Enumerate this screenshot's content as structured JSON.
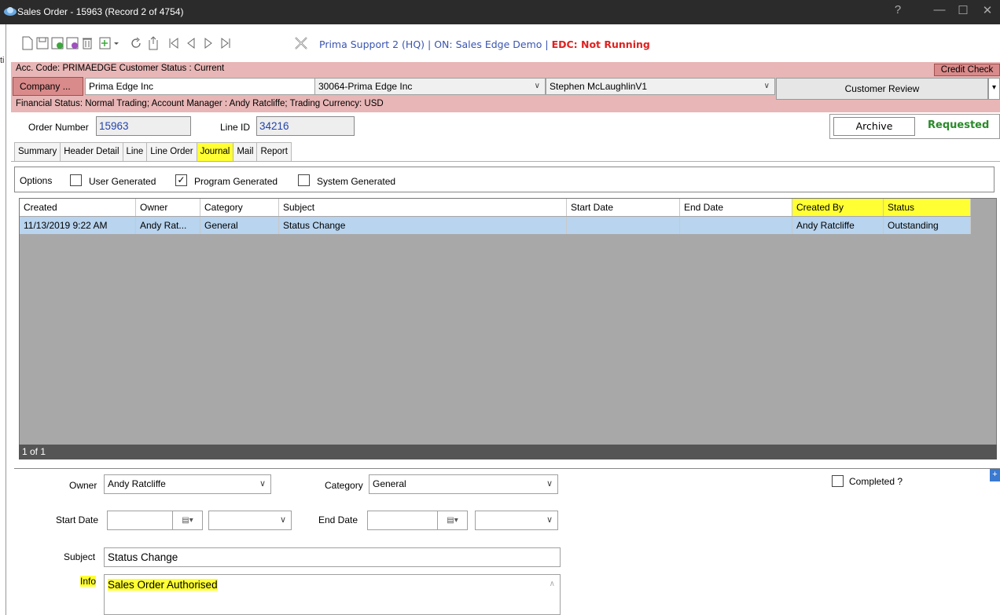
{
  "window": {
    "title": "Sales Order - 15963  (Record 2 of 4754)",
    "help": "?",
    "minimize": "—",
    "maximize": "☐",
    "close": "✕"
  },
  "left_strip_fragment": "ti",
  "toolbar": {
    "connection_text": "Prima Support 2 (HQ) | ON: Sales Edge Demo | ",
    "edc_status": "EDC: Not Running"
  },
  "customer": {
    "acc_line": "Acc. Code: PRIMAEDGE  Customer Status : Current",
    "credit_check": "Credit Check",
    "company_button": "Company ...",
    "company_name": "Prima Edge Inc",
    "account_select": "30064-Prima Edge Inc",
    "contact_select": "Stephen McLaughlinV1",
    "review_button": "Customer Review",
    "financial_line": "Financial Status: Normal Trading;  Account Manager : Andy Ratcliffe; Trading Currency: USD"
  },
  "order": {
    "order_number_label": "Order Number",
    "order_number": "15963",
    "line_id_label": "Line ID",
    "line_id": "34216",
    "archive_button": "Archive",
    "status": "Requested"
  },
  "tabs": [
    "Summary",
    "Header Detail",
    "Line",
    "Line Order",
    "Journal",
    "Mail",
    "Report"
  ],
  "options": {
    "label": "Options",
    "user_generated": "User Generated",
    "program_generated": "Program Generated",
    "system_generated": "System Generated"
  },
  "grid": {
    "columns": [
      "Created",
      "Owner",
      "Category",
      "Subject",
      "Start Date",
      "End Date",
      "Created By",
      "Status"
    ],
    "rows": [
      [
        "11/13/2019 9:22 AM",
        "Andy Rat...",
        "General",
        "Status Change",
        "",
        "",
        "Andy Ratcliffe",
        "Outstanding"
      ]
    ],
    "pager": "1 of 1"
  },
  "detail": {
    "owner_label": "Owner",
    "owner_value": "Andy Ratcliffe",
    "category_label": "Category",
    "category_value": "General",
    "completed_label": "Completed ?",
    "start_date_label": "Start Date",
    "end_date_label": "End Date",
    "subject_label": "Subject",
    "subject_value": "Status Change",
    "info_label": "Info",
    "info_value": "Sales Order Authorised",
    "plus": "+"
  },
  "colors": {
    "highlight": "#ffff33",
    "customer_band": "#e8b6b6",
    "selected_row": "#b8d4ee",
    "edc_red": "#e02020",
    "requested_green": "#2a8a2a"
  }
}
